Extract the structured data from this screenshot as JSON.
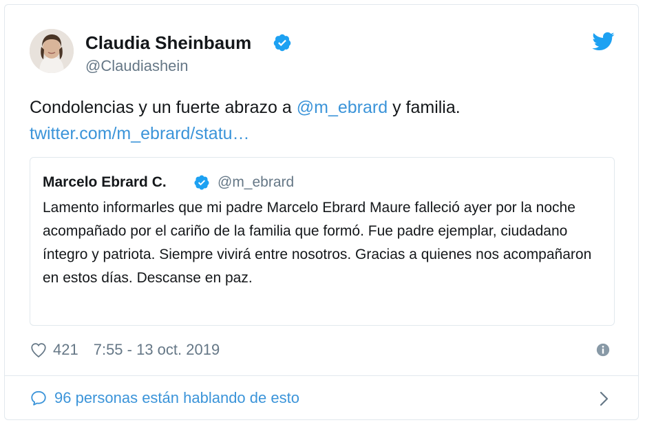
{
  "tweet": {
    "author": {
      "name": "Claudia Sheinbaum",
      "handle": "@Claudiashein",
      "verified": true
    },
    "text_prefix": "Condolencias y un fuerte abrazo a ",
    "mention": "@m_ebrard",
    "text_suffix": " y familia.",
    "link": "twitter.com/m_ebrard/statu…",
    "quoted": {
      "name": "Marcelo Ebrard C.",
      "handle": "@m_ebrard",
      "verified": true,
      "text": "Lamento informarles que mi padre Marcelo Ebrard Maure falleció ayer por la noche acompañado por el cariño de la familia que formó. Fue padre ejemplar, ciudadano íntegro y patriota. Siempre vivirá entre nosotros. Gracias a quienes nos acompañaron en estos días. Descanse en paz."
    },
    "likes": "421",
    "timestamp": "7:55 - 13 oct. 2019",
    "conversation": "96 personas están hablando de esto"
  },
  "icons": {
    "verified": "verified-badge-icon",
    "bird": "twitter-bird-icon",
    "heart": "heart-icon",
    "info": "info-icon",
    "bubble": "reply-bubble-icon",
    "chevron": "chevron-right-icon"
  },
  "colors": {
    "accent": "#1da1f2",
    "link": "#3b94d9",
    "secondary_text": "#657786",
    "border": "#e1e8ed"
  }
}
